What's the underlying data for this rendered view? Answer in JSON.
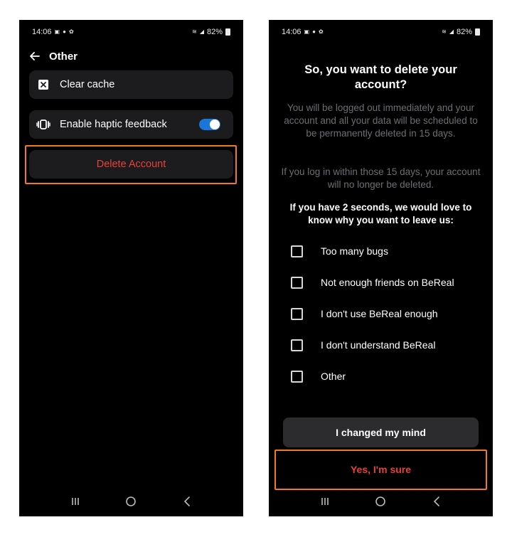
{
  "status_bar": {
    "time": "14:06",
    "battery": "82%"
  },
  "settings_screen": {
    "title": "Other",
    "clear_cache": "Clear cache",
    "haptic_feedback": "Enable haptic feedback",
    "haptic_enabled": true,
    "delete_account": "Delete Account"
  },
  "delete_dialog": {
    "title": "So, you want to delete your account?",
    "body_1": "You will be logged out immediately and your account and all your data will be scheduled to be permanently deleted in 15 days.",
    "body_2": "If you log in within those 15 days, your account will no longer be deleted.",
    "question": "If you have 2 seconds, we would love to know why you want to leave us:",
    "reasons": [
      {
        "label": "Too many bugs",
        "checked": false
      },
      {
        "label": "Not enough friends on BeReal",
        "checked": false
      },
      {
        "label": "I don't use BeReal enough",
        "checked": false
      },
      {
        "label": "I don't understand BeReal",
        "checked": false
      },
      {
        "label": "Other",
        "checked": false
      }
    ],
    "changed_mind": "I changed my mind",
    "confirm": "Yes, I'm sure"
  },
  "colors": {
    "background": "#000000",
    "card": "#1c1c1e",
    "danger": "#e8403a",
    "highlight": "#f07a1c",
    "toggle_on": "#1b76d9",
    "muted_text": "#6e6e73"
  },
  "icons": [
    "back-arrow-icon",
    "clear-cache-icon",
    "haptic-vibration-icon",
    "recents-icon",
    "home-icon",
    "back-nav-icon",
    "checkbox-icon"
  ]
}
